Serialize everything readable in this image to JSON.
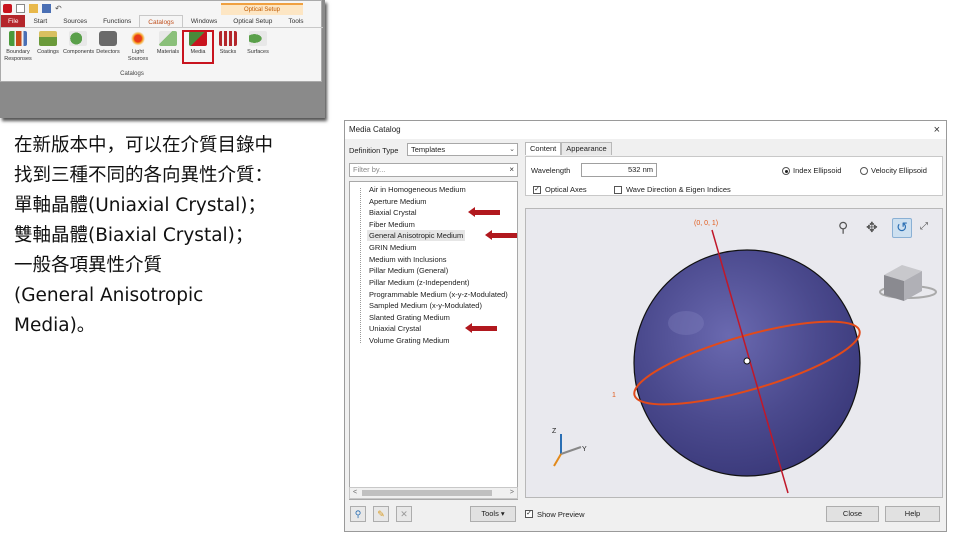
{
  "ribbon": {
    "context_group": "Optical Setup",
    "tabs": [
      "File",
      "Start",
      "Sources",
      "Functions",
      "Catalogs",
      "Windows",
      "Optical Setup",
      "Tools"
    ],
    "active_tab": "Catalogs",
    "buttons": [
      {
        "label": "Boundary\nResponses",
        "icon": "boundary-icon"
      },
      {
        "label": "Coatings",
        "icon": "coatings-icon"
      },
      {
        "label": "Components",
        "icon": "components-icon"
      },
      {
        "label": "Detectors",
        "icon": "detectors-icon"
      },
      {
        "label": "Light\nSources",
        "icon": "light-sources-icon"
      },
      {
        "label": "Materials",
        "icon": "materials-icon"
      },
      {
        "label": "Media",
        "icon": "media-icon"
      },
      {
        "label": "Stacks",
        "icon": "stacks-icon"
      },
      {
        "label": "Surfaces",
        "icon": "surfaces-icon"
      }
    ],
    "selected_button": "Media",
    "group_label": "Catalogs"
  },
  "note": {
    "lines": [
      "在新版本中，可以在介質目錄中",
      "找到三種不同的各向異性介質：",
      "單軸晶體(Uniaxial Crystal)；",
      "雙軸晶體(Biaxial Crystal)；",
      "一般各項異性介質",
      "(General Anisotropic",
      "Media)。"
    ]
  },
  "dialog": {
    "title": "Media Catalog",
    "close": "×",
    "definition_type_label": "Definition Type",
    "definition_type_value": "Templates",
    "filter_placeholder": "Filter by...",
    "filter_clear": "×",
    "items": [
      "Air in Homogeneous Medium",
      "Aperture Medium",
      "Biaxial Crystal",
      "Fiber Medium",
      "General Anisotropic Medium",
      "GRIN Medium",
      "Medium with Inclusions",
      "Pillar Medium (General)",
      "Pillar Medium (z-Independent)",
      "Programmable Medium (x-y-z-Modulated)",
      "Sampled Medium (x-y-Modulated)",
      "Slanted Grating Medium",
      "Uniaxial Crystal",
      "Volume Grating Medium"
    ],
    "highlighted_item": "General Anisotropic Medium",
    "tabs": [
      "Content",
      "Appearance"
    ],
    "active_tab": "Content",
    "wavelength_label": "Wavelength",
    "wavelength_value": "532 nm",
    "optical_axes_label": "Optical Axes",
    "optical_axes_checked": true,
    "wave_dir_label": "Wave Direction & Eigen Indices",
    "wave_dir_checked": false,
    "index_ellipsoid_label": "Index Ellipsoid",
    "velocity_ellipsoid_label": "Velocity Ellipsoid",
    "selected_ellipsoid": "Index Ellipsoid",
    "axis_label_top": "(0, 0, 1)",
    "axis_label_left": "1",
    "triad_labels": {
      "z": "Z",
      "y": "Y"
    },
    "tools_label": "Tools",
    "show_preview_label": "Show Preview",
    "show_preview_checked": true,
    "close_label": "Close",
    "help_label": "Help",
    "colors": {
      "sphere": "#4b4a8e",
      "axis_red": "#c0182a",
      "ring_orange": "#e24a1a",
      "label_orange": "#e25a1a",
      "marker_red": "#b1181e"
    }
  }
}
